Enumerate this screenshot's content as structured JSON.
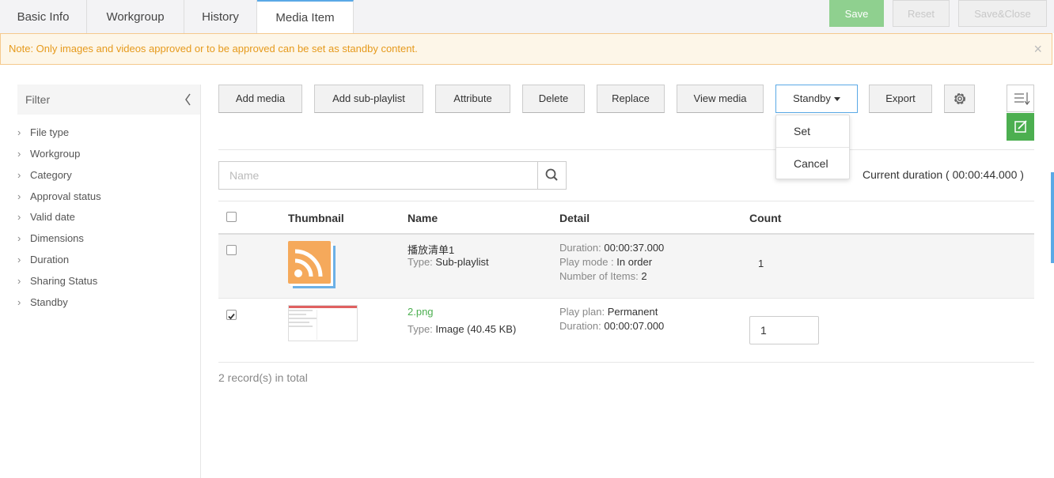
{
  "tabs": [
    {
      "label": "Basic Info"
    },
    {
      "label": "Workgroup"
    },
    {
      "label": "History"
    },
    {
      "label": "Media Item"
    }
  ],
  "top_actions": {
    "save": "Save",
    "reset": "Reset",
    "save_close": "Save&Close"
  },
  "note": {
    "text": "Note: Only images and videos approved or to be approved can be set as standby content.",
    "close": "×"
  },
  "filter": {
    "title": "Filter",
    "items": [
      "File type",
      "Workgroup",
      "Category",
      "Approval status",
      "Valid date",
      "Dimensions",
      "Duration",
      "Sharing Status",
      "Standby"
    ]
  },
  "toolbar": {
    "add_media": "Add media",
    "add_sub_playlist": "Add sub-playlist",
    "attribute": "Attribute",
    "delete": "Delete",
    "replace": "Replace",
    "view_media": "View media",
    "standby": "Standby",
    "export": "Export"
  },
  "standby_menu": [
    "Set",
    "Cancel"
  ],
  "search": {
    "placeholder": "Name"
  },
  "current_duration": "Current duration ( 00:00:44.000 )",
  "table": {
    "headers": {
      "thumbnail": "Thumbnail",
      "name": "Name",
      "detail": "Detail",
      "count": "Count"
    },
    "rows": [
      {
        "name": "播放清单1",
        "type_label": "Type:",
        "type_value": "Sub-playlist",
        "details": [
          {
            "label": "Duration:",
            "value": "00:00:37.000"
          },
          {
            "label": "Play mode :",
            "value": "In order"
          },
          {
            "label": "Number of Items:",
            "value": "2"
          }
        ],
        "count": "1",
        "checked": false
      },
      {
        "name": "2.png",
        "type_label": "Type:",
        "type_value": "Image (40.45 KB)",
        "details": [
          {
            "label": "Play plan:",
            "value": "Permanent"
          },
          {
            "label": "Duration:",
            "value": "00:00:07.000"
          }
        ],
        "count": "1",
        "checked": true
      }
    ]
  },
  "total": "2 record(s) in total",
  "colors": {
    "accent": "#5aa9e6",
    "primary_green": "#8fd08f",
    "warning": "#e69a1c",
    "edit_green": "#4caf50"
  },
  "icons": {
    "search": "search-icon",
    "settings": "gear-icon",
    "column": "column-list-icon",
    "edit": "edit-icon",
    "rss": "rss-icon"
  }
}
